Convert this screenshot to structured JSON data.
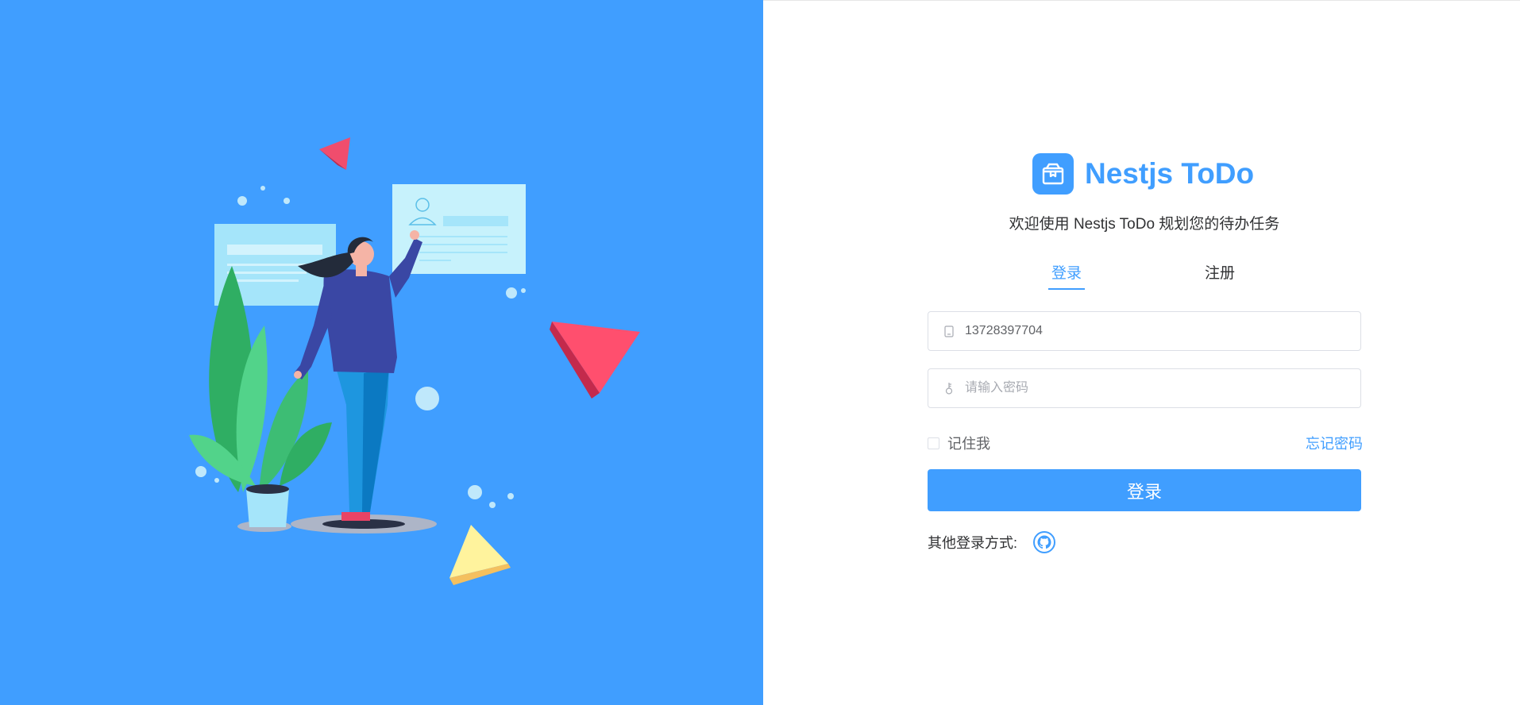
{
  "brand": {
    "title": "Nestjs ToDo",
    "logo_icon": "box-icon"
  },
  "subtitle": "欢迎使用 Nestjs ToDo 规划您的待办任务",
  "tabs": [
    {
      "label": "登录",
      "active": true
    },
    {
      "label": "注册",
      "active": false
    }
  ],
  "form": {
    "phone": {
      "value": "13728397704",
      "placeholder": "",
      "icon": "phone-icon"
    },
    "password": {
      "value": "",
      "placeholder": "请输入密码",
      "icon": "key-icon"
    },
    "remember_label": "记住我",
    "remember_checked": false,
    "forgot_label": "忘记密码",
    "submit_label": "登录"
  },
  "other_login": {
    "label": "其他登录方式:",
    "providers": [
      {
        "icon": "github-icon"
      }
    ]
  },
  "colors": {
    "primary": "#409eff",
    "text": "#303133",
    "muted": "#606266",
    "border": "#dcdfe6"
  }
}
